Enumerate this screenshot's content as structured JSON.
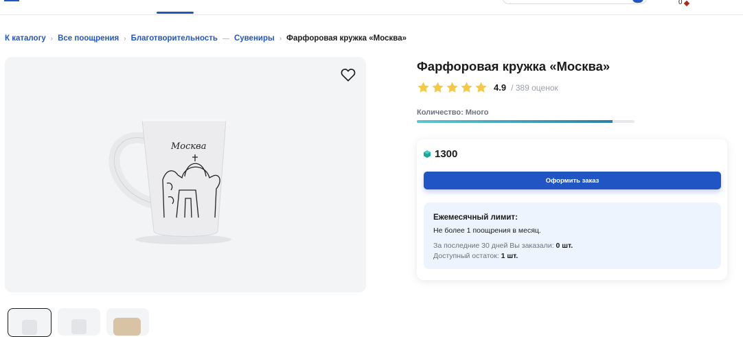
{
  "header": {
    "cart_count": "0"
  },
  "breadcrumb": [
    {
      "label": "К каталогу"
    },
    {
      "label": "Все поощрения"
    },
    {
      "label": "Благотворительность"
    },
    {
      "label": "Сувениры"
    }
  ],
  "breadcrumb_current": "Фарфоровая кружка «Москва»",
  "product": {
    "title": "Фарфоровая кружка «Москва»",
    "rating": {
      "stars": 5,
      "value": "4.9",
      "count": "/ 389 оценок"
    },
    "quantity_label": "Количество: Много",
    "quantity_fraction": 0.9,
    "image_label": "Москва",
    "thumbnail_count": 3
  },
  "purchase": {
    "price": "1300",
    "currency_icon": "gem-icon",
    "order_button": "Оформить заказ",
    "limit": {
      "title": "Ежемесячный лимит:",
      "text": "Не более 1 поощрения в месяц.",
      "ordered_label": "За последние 30 дней Вы заказали:",
      "ordered_value": "0 шт.",
      "remaining_label": "Доступный остаток:",
      "remaining_value": "1 шт."
    }
  },
  "colors": {
    "accent": "#2255c4",
    "star": "#f6c945",
    "gem": "#1aa89a",
    "limit_bg": "#eef4fd"
  }
}
